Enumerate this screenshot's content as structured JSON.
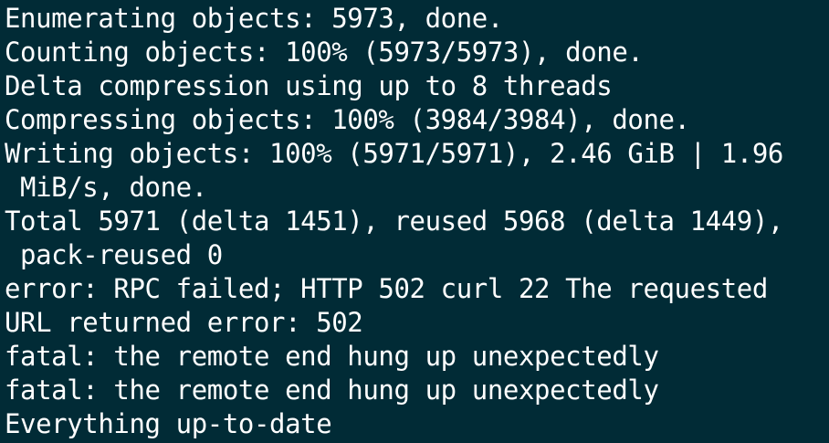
{
  "terminal": {
    "lines": [
      "Enumerating objects: 5973, done.",
      "Counting objects: 100% (5973/5973), done.",
      "Delta compression using up to 8 threads",
      "Compressing objects: 100% (3984/3984), done.",
      "Writing objects: 100% (5971/5971), 2.46 GiB | 1.96",
      " MiB/s, done.",
      "Total 5971 (delta 1451), reused 5968 (delta 1449),",
      " pack-reused 0",
      "error: RPC failed; HTTP 502 curl 22 The requested",
      "URL returned error: 502",
      "fatal: the remote end hung up unexpectedly",
      "fatal: the remote end hung up unexpectedly",
      "Everything up-to-date"
    ]
  },
  "colors": {
    "background": "#012b36",
    "text": "#ffffff"
  }
}
